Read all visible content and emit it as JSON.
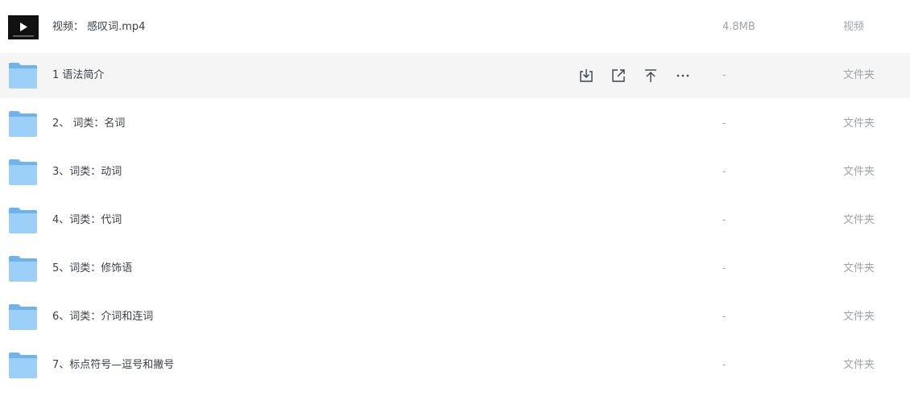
{
  "files": [
    {
      "name": "视频：  感叹词.mp4",
      "size": "4.8MB",
      "type": "视频",
      "icon": "video-thumbnail-icon"
    },
    {
      "name": "1 语法简介",
      "size": "-",
      "type": "文件夹",
      "icon": "folder-icon"
    },
    {
      "name": "2、 词类：名词",
      "size": "-",
      "type": "文件夹",
      "icon": "folder-icon"
    },
    {
      "name": "3、词类：动词",
      "size": "-",
      "type": "文件夹",
      "icon": "folder-icon"
    },
    {
      "name": "4、词类：代词",
      "size": "-",
      "type": "文件夹",
      "icon": "folder-icon"
    },
    {
      "name": "5、词类：修饰语",
      "size": "-",
      "type": "文件夹",
      "icon": "folder-icon"
    },
    {
      "name": "6、词类：介词和连词",
      "size": "-",
      "type": "文件夹",
      "icon": "folder-icon"
    },
    {
      "name": "7、标点符号—逗号和撇号",
      "size": "-",
      "type": "文件夹",
      "icon": "folder-icon"
    }
  ],
  "row_actions": [
    {
      "name": "download-icon"
    },
    {
      "name": "share-icon"
    },
    {
      "name": "move-to-top-icon"
    },
    {
      "name": "more-icon"
    }
  ],
  "colors": {
    "hover_row": "#f5f5f6",
    "folder_blue": "#8cc7f5",
    "text_primary": "#3a3f4a",
    "text_secondary": "#9ea3ab"
  }
}
